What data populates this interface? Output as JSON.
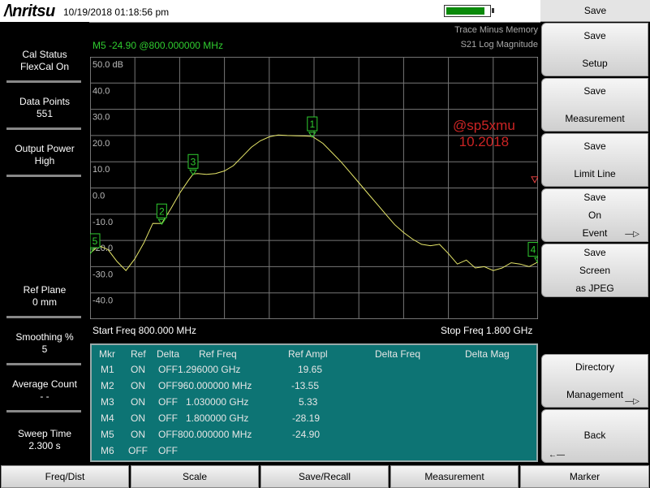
{
  "header": {
    "logo": "/\\nritsu",
    "datetime": "10/19/2018 01:18:56 pm",
    "battery_level": 0.9,
    "battery_color": "#0a8a0a"
  },
  "left_panel": [
    {
      "label": "Cal Status",
      "value": "FlexCal On"
    },
    {
      "label": "Data Points",
      "value": "551"
    },
    {
      "label": "Output Power",
      "value": "High"
    },
    {
      "label": "Ref Plane",
      "value": "0 mm"
    },
    {
      "label": "Smoothing %",
      "value": "5"
    },
    {
      "label": "Average Count",
      "value": "- -"
    },
    {
      "label": "Sweep Time",
      "value": "2.300 s"
    }
  ],
  "trace_info": {
    "line1": "Trace Minus Memory",
    "line2": "S21 Log Magnitude"
  },
  "marker_readout": "M5 -24.90 @800.000000 MHz",
  "chart_data": {
    "type": "line",
    "y_unit_label": "50.0 dB",
    "y_tick_labels": [
      "40.0",
      "30.0",
      "20.0",
      "10.0",
      "0.0",
      "-10.0",
      "-20.0",
      "-30.0",
      "-40.0"
    ],
    "ylim": [
      -50,
      50
    ],
    "xlim_mhz": [
      800,
      1800
    ],
    "grid": true,
    "x_mhz": [
      800,
      820,
      840,
      860,
      880,
      900,
      920,
      940,
      960,
      980,
      1000,
      1020,
      1030,
      1040,
      1060,
      1080,
      1100,
      1120,
      1140,
      1160,
      1180,
      1200,
      1220,
      1240,
      1260,
      1280,
      1296,
      1320,
      1340,
      1360,
      1380,
      1400,
      1420,
      1440,
      1460,
      1480,
      1500,
      1520,
      1540,
      1560,
      1580,
      1600,
      1620,
      1640,
      1660,
      1680,
      1700,
      1720,
      1740,
      1760,
      1780,
      1800
    ],
    "y_db": [
      -24.9,
      -22.0,
      -23.5,
      -28.0,
      -31.5,
      -27.0,
      -21.0,
      -13.5,
      -13.55,
      -8.0,
      -2.0,
      3.0,
      5.33,
      5.5,
      5.2,
      5.5,
      6.5,
      8.5,
      12.0,
      15.5,
      18.0,
      19.5,
      20.2,
      20.0,
      19.9,
      19.8,
      19.65,
      17.0,
      13.5,
      10.0,
      6.0,
      2.0,
      -2.0,
      -6.0,
      -10.0,
      -14.0,
      -17.0,
      -19.5,
      -21.5,
      -22.0,
      -21.5,
      -25.0,
      -29.0,
      -27.5,
      -30.5,
      -30.0,
      -31.5,
      -30.5,
      -28.5,
      -29.0,
      -30.0,
      -28.19
    ],
    "trace_color": "#e8e86a",
    "grid_color": "#777777",
    "markers": [
      {
        "id": "1",
        "x_mhz": 1296,
        "y_db": 19.65
      },
      {
        "id": "2",
        "x_mhz": 960,
        "y_db": -13.55
      },
      {
        "id": "3",
        "x_mhz": 1030,
        "y_db": 5.33
      },
      {
        "id": "4",
        "x_mhz": 1800,
        "y_db": -28.19
      },
      {
        "id": "5",
        "x_mhz": 800,
        "y_db": -24.9
      }
    ],
    "marker_color": "#2fcc2f",
    "ref_marker_y_db": 3.0,
    "ref_marker_color": "#e04040"
  },
  "freq": {
    "start": "Start Freq 800.000 MHz",
    "stop": "Stop Freq 1.800 GHz"
  },
  "watermark": {
    "line1": "@sp5xmu",
    "line2": "10.2018"
  },
  "marker_table": {
    "headers": [
      "Mkr",
      "Ref",
      "Delta",
      "Ref Freq",
      "Ref Ampl",
      "Delta Freq",
      "Delta Mag"
    ],
    "rows": [
      {
        "mkr": "M1",
        "ref": "ON",
        "delta": "OFF",
        "ref_freq": "1.296000 GHz",
        "ref_ampl": "19.65"
      },
      {
        "mkr": "M2",
        "ref": "ON",
        "delta": "OFF",
        "ref_freq": "960.000000 MHz",
        "ref_ampl": "-13.55"
      },
      {
        "mkr": "M3",
        "ref": "ON",
        "delta": "OFF",
        "ref_freq": "1.030000 GHz",
        "ref_ampl": "5.33"
      },
      {
        "mkr": "M4",
        "ref": "ON",
        "delta": "OFF",
        "ref_freq": "1.800000 GHz",
        "ref_ampl": "-28.19"
      },
      {
        "mkr": "M5",
        "ref": "ON",
        "delta": "OFF",
        "ref_freq": "800.000000 MHz",
        "ref_ampl": "-24.90"
      },
      {
        "mkr": "M6",
        "ref": "OFF",
        "delta": "OFF",
        "ref_freq": "",
        "ref_ampl": ""
      }
    ]
  },
  "right_menu": {
    "title": "Save",
    "keys": [
      {
        "line1": "Save",
        "line2": "Setup"
      },
      {
        "line1": "Save",
        "line2": "Measurement"
      },
      {
        "line1": "Save",
        "line2": "Limit Line"
      },
      {
        "line1": "Save",
        "line2": "On",
        "line3": "Event",
        "arrow": "—▷"
      },
      {
        "line1": "Save",
        "line2": "Screen",
        "line3": "as JPEG"
      },
      {
        "line1": "Directory",
        "line2": "Management",
        "arrow": "—▷"
      },
      {
        "line1": "Back",
        "arrow": "←—"
      }
    ]
  },
  "bottom_tabs": [
    "Freq/Dist",
    "Scale",
    "Save/Recall",
    "Measurement",
    "Marker"
  ]
}
